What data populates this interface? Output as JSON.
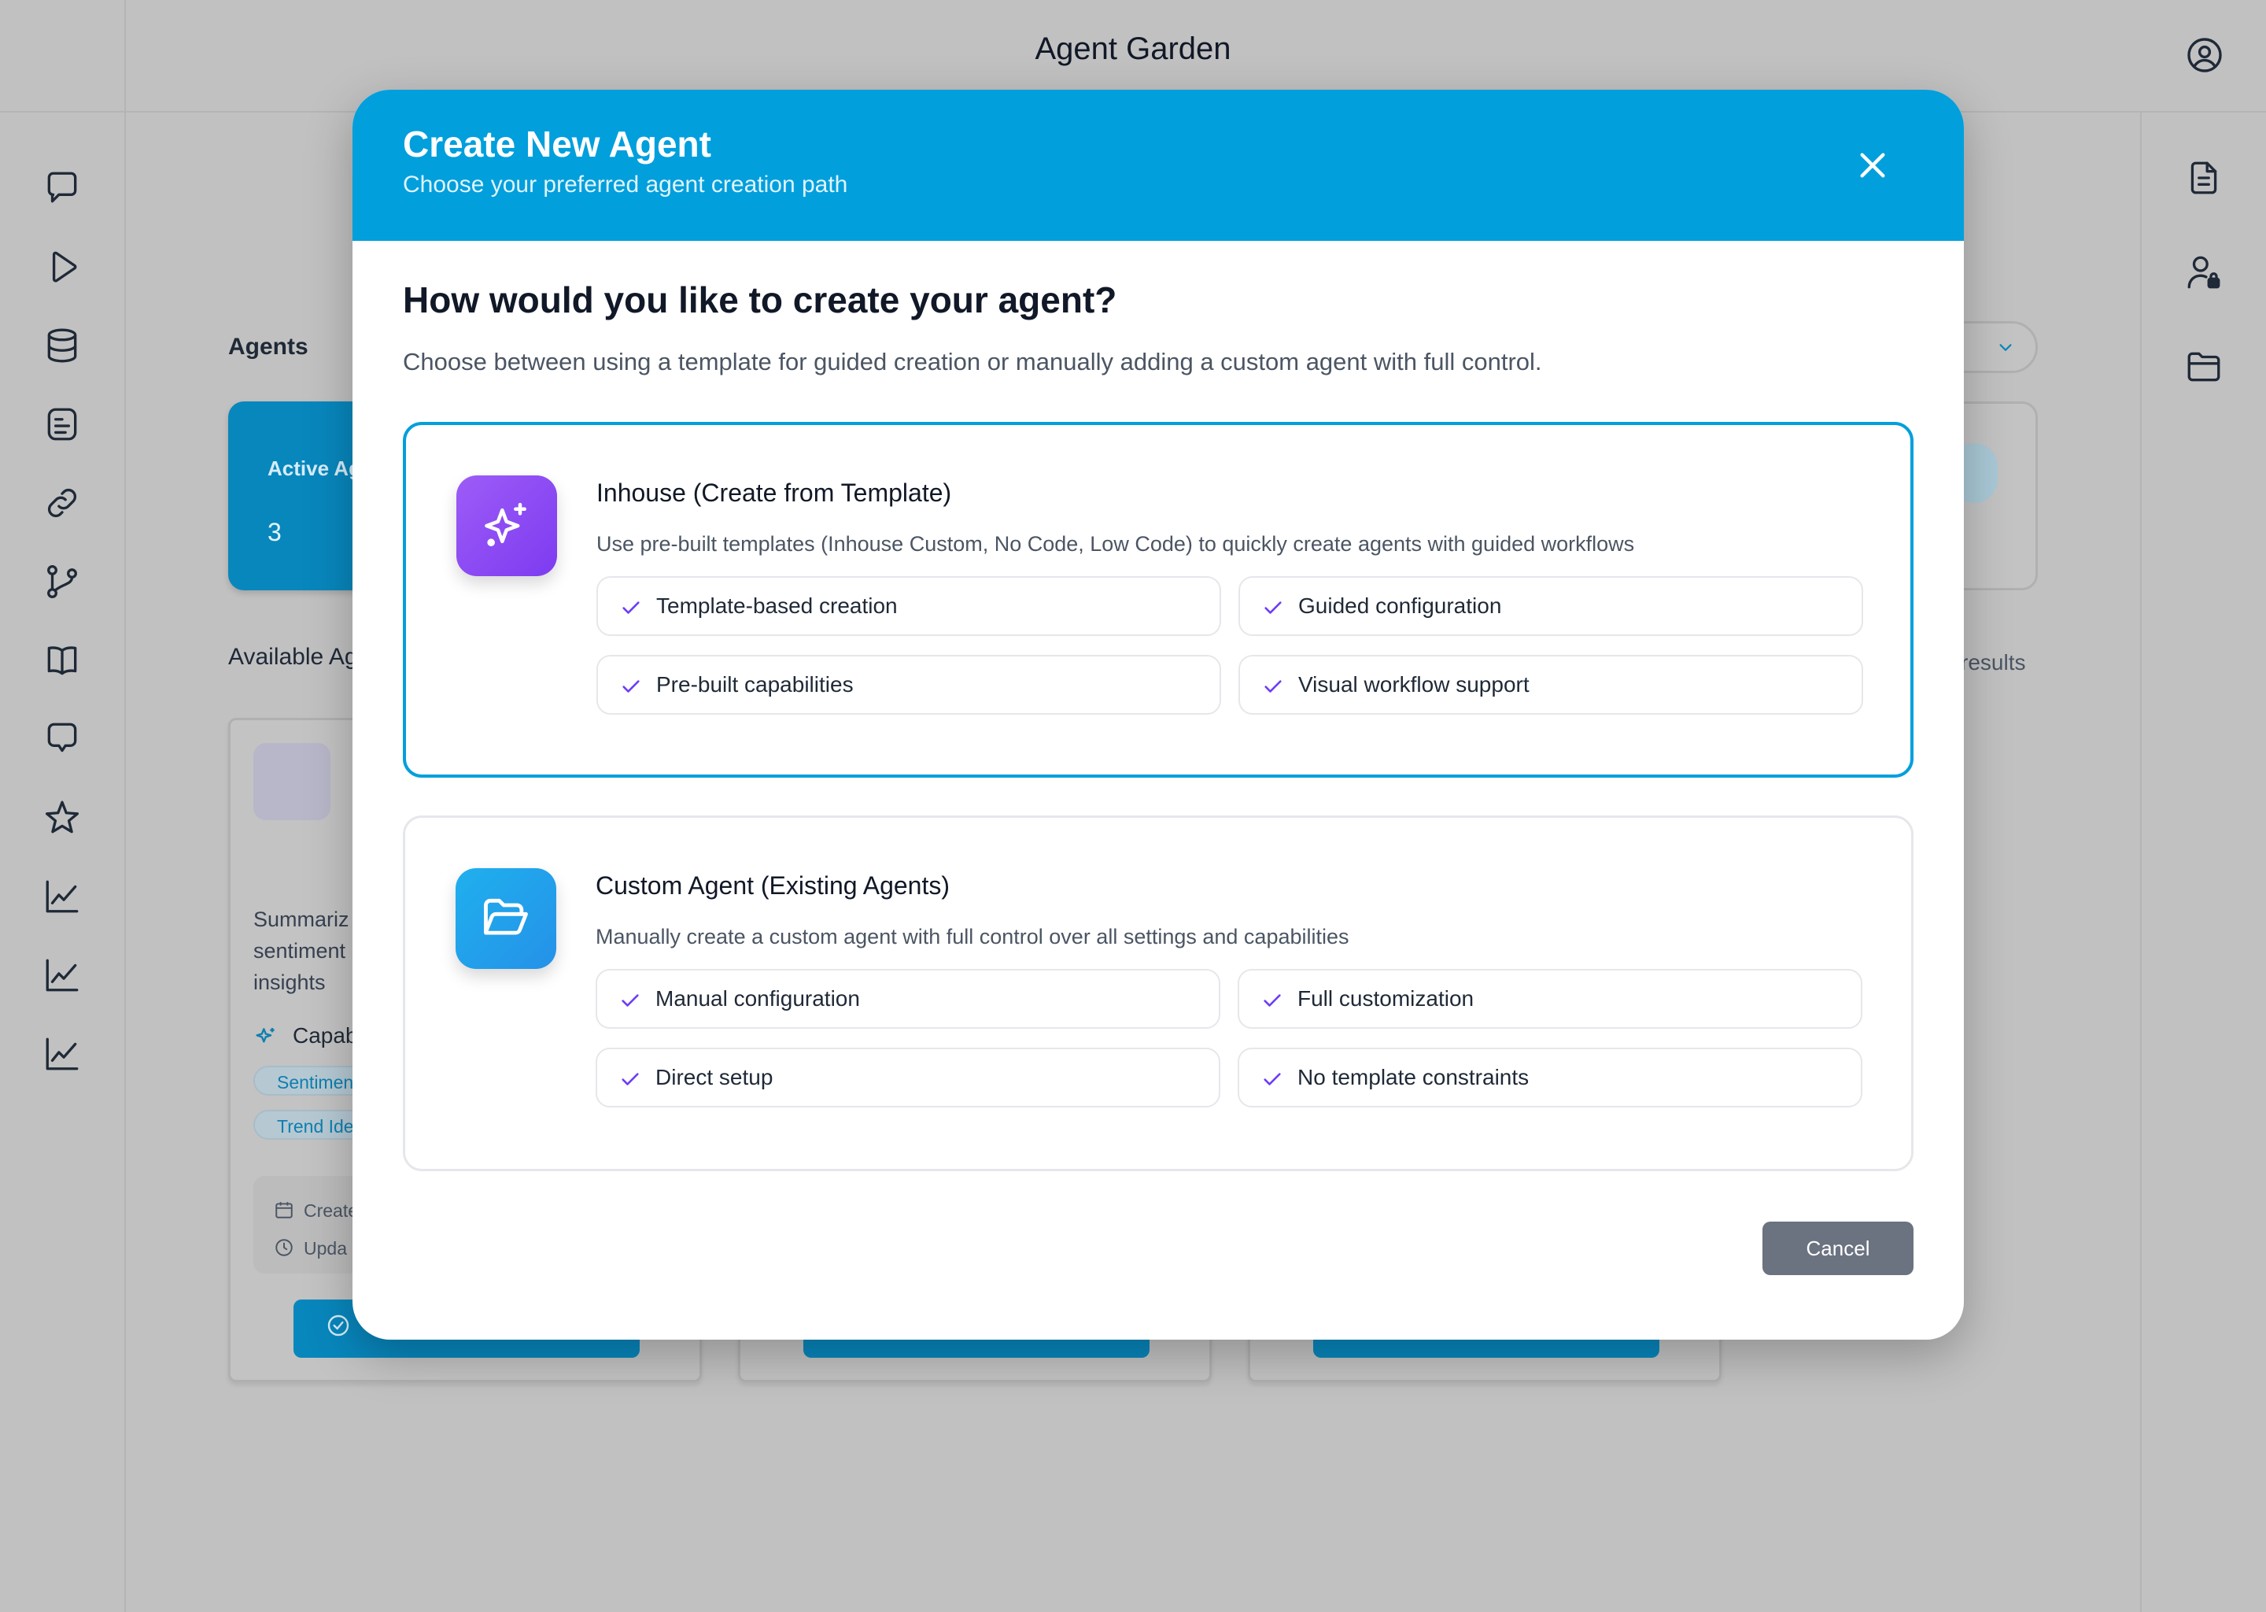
{
  "app": {
    "title": "Agent Garden",
    "left_rail_icons": [
      "chat-icon",
      "play-icon",
      "database-icon",
      "document-icon",
      "link-icon",
      "git-branch-icon",
      "book-icon",
      "message-icon",
      "star-icon",
      "chart-icon",
      "chart-icon",
      "chart-icon"
    ],
    "right_rail_icons": [
      "file-text-icon",
      "user-lock-icon",
      "folder-icon"
    ]
  },
  "background": {
    "agents_heading": "Agents",
    "stat_label": "Active Ag",
    "stat_value": "3",
    "available_heading": "Available Ag",
    "results_text": "results",
    "card1": {
      "desc_lines": [
        "Summariz",
        "sentiment",
        "insights"
      ],
      "capabilities_label": "Capab",
      "tags": [
        "Sentimen",
        "Trend Ide"
      ],
      "meta_created": "Create",
      "meta_updated": "Upda"
    }
  },
  "modal": {
    "title": "Create New Agent",
    "subtitle": "Choose your preferred agent creation path",
    "question": "How would you like to create your agent?",
    "intro": "Choose between using a template for guided creation or manually adding a custom agent with full control.",
    "options": [
      {
        "title": "Inhouse (Create from Template)",
        "description": "Use pre-built templates (Inhouse Custom, No Code, Low Code) to quickly create agents with guided workflows",
        "icon": "sparkles-icon",
        "selected": true,
        "features": [
          "Template-based creation",
          "Guided configuration",
          "Pre-built capabilities",
          "Visual workflow support"
        ]
      },
      {
        "title": "Custom Agent (Existing Agents)",
        "description": "Manually create a custom agent with full control over all settings and capabilities",
        "icon": "folder-open-icon",
        "selected": false,
        "features": [
          "Manual configuration",
          "Full customization",
          "Direct setup",
          "No template constraints"
        ]
      }
    ],
    "cancel_label": "Cancel"
  },
  "colors": {
    "header": "#019fdc",
    "selected_border": "#019fdc",
    "check": "#6d3df5",
    "cancel": "#6b7280",
    "overlay_bg": "#c1c1c1"
  }
}
